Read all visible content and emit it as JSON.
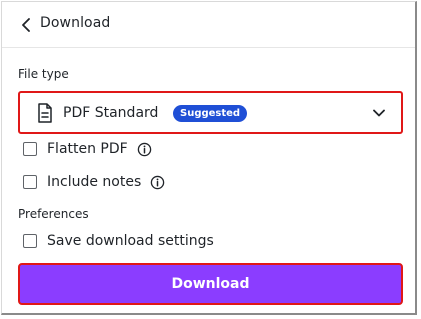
{
  "header": {
    "title": "Download",
    "back_icon": "chevron-left-icon"
  },
  "file_type": {
    "label": "File type",
    "selected_value": "PDF Standard",
    "badge": "Suggested",
    "file_icon": "document-icon",
    "dropdown_icon": "chevron-down-icon"
  },
  "options": {
    "flatten_pdf": {
      "label": "Flatten PDF",
      "checked": false,
      "info_icon": "info-icon"
    },
    "include_notes": {
      "label": "Include notes",
      "checked": false,
      "info_icon": "info-icon"
    }
  },
  "preferences": {
    "label": "Preferences",
    "save_settings": {
      "label": "Save download settings",
      "checked": false
    }
  },
  "actions": {
    "download_label": "Download"
  },
  "colors": {
    "primary": "#8b3dff",
    "badge": "#1f4fd6",
    "highlight_border": "#e01818"
  }
}
